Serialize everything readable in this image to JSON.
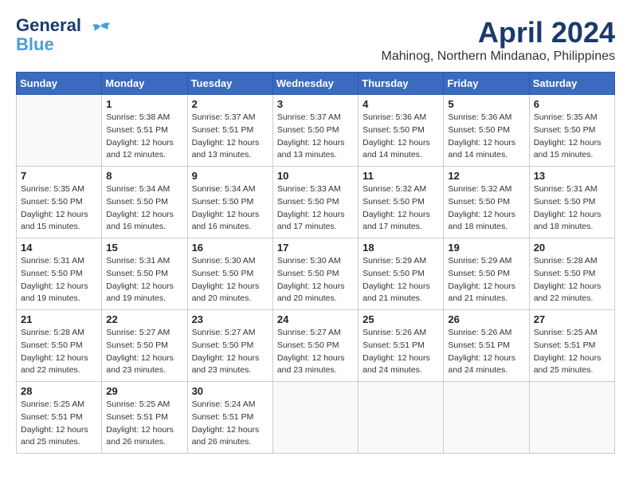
{
  "header": {
    "logo_line1": "General",
    "logo_line2": "Blue",
    "month_year": "April 2024",
    "location": "Mahinog, Northern Mindanao, Philippines"
  },
  "days_of_week": [
    "Sunday",
    "Monday",
    "Tuesday",
    "Wednesday",
    "Thursday",
    "Friday",
    "Saturday"
  ],
  "weeks": [
    [
      {
        "day": "",
        "info": ""
      },
      {
        "day": "1",
        "info": "Sunrise: 5:38 AM\nSunset: 5:51 PM\nDaylight: 12 hours\nand 12 minutes."
      },
      {
        "day": "2",
        "info": "Sunrise: 5:37 AM\nSunset: 5:51 PM\nDaylight: 12 hours\nand 13 minutes."
      },
      {
        "day": "3",
        "info": "Sunrise: 5:37 AM\nSunset: 5:50 PM\nDaylight: 12 hours\nand 13 minutes."
      },
      {
        "day": "4",
        "info": "Sunrise: 5:36 AM\nSunset: 5:50 PM\nDaylight: 12 hours\nand 14 minutes."
      },
      {
        "day": "5",
        "info": "Sunrise: 5:36 AM\nSunset: 5:50 PM\nDaylight: 12 hours\nand 14 minutes."
      },
      {
        "day": "6",
        "info": "Sunrise: 5:35 AM\nSunset: 5:50 PM\nDaylight: 12 hours\nand 15 minutes."
      }
    ],
    [
      {
        "day": "7",
        "info": "Sunrise: 5:35 AM\nSunset: 5:50 PM\nDaylight: 12 hours\nand 15 minutes."
      },
      {
        "day": "8",
        "info": "Sunrise: 5:34 AM\nSunset: 5:50 PM\nDaylight: 12 hours\nand 16 minutes."
      },
      {
        "day": "9",
        "info": "Sunrise: 5:34 AM\nSunset: 5:50 PM\nDaylight: 12 hours\nand 16 minutes."
      },
      {
        "day": "10",
        "info": "Sunrise: 5:33 AM\nSunset: 5:50 PM\nDaylight: 12 hours\nand 17 minutes."
      },
      {
        "day": "11",
        "info": "Sunrise: 5:32 AM\nSunset: 5:50 PM\nDaylight: 12 hours\nand 17 minutes."
      },
      {
        "day": "12",
        "info": "Sunrise: 5:32 AM\nSunset: 5:50 PM\nDaylight: 12 hours\nand 18 minutes."
      },
      {
        "day": "13",
        "info": "Sunrise: 5:31 AM\nSunset: 5:50 PM\nDaylight: 12 hours\nand 18 minutes."
      }
    ],
    [
      {
        "day": "14",
        "info": "Sunrise: 5:31 AM\nSunset: 5:50 PM\nDaylight: 12 hours\nand 19 minutes."
      },
      {
        "day": "15",
        "info": "Sunrise: 5:31 AM\nSunset: 5:50 PM\nDaylight: 12 hours\nand 19 minutes."
      },
      {
        "day": "16",
        "info": "Sunrise: 5:30 AM\nSunset: 5:50 PM\nDaylight: 12 hours\nand 20 minutes."
      },
      {
        "day": "17",
        "info": "Sunrise: 5:30 AM\nSunset: 5:50 PM\nDaylight: 12 hours\nand 20 minutes."
      },
      {
        "day": "18",
        "info": "Sunrise: 5:29 AM\nSunset: 5:50 PM\nDaylight: 12 hours\nand 21 minutes."
      },
      {
        "day": "19",
        "info": "Sunrise: 5:29 AM\nSunset: 5:50 PM\nDaylight: 12 hours\nand 21 minutes."
      },
      {
        "day": "20",
        "info": "Sunrise: 5:28 AM\nSunset: 5:50 PM\nDaylight: 12 hours\nand 22 minutes."
      }
    ],
    [
      {
        "day": "21",
        "info": "Sunrise: 5:28 AM\nSunset: 5:50 PM\nDaylight: 12 hours\nand 22 minutes."
      },
      {
        "day": "22",
        "info": "Sunrise: 5:27 AM\nSunset: 5:50 PM\nDaylight: 12 hours\nand 23 minutes."
      },
      {
        "day": "23",
        "info": "Sunrise: 5:27 AM\nSunset: 5:50 PM\nDaylight: 12 hours\nand 23 minutes."
      },
      {
        "day": "24",
        "info": "Sunrise: 5:27 AM\nSunset: 5:50 PM\nDaylight: 12 hours\nand 23 minutes."
      },
      {
        "day": "25",
        "info": "Sunrise: 5:26 AM\nSunset: 5:51 PM\nDaylight: 12 hours\nand 24 minutes."
      },
      {
        "day": "26",
        "info": "Sunrise: 5:26 AM\nSunset: 5:51 PM\nDaylight: 12 hours\nand 24 minutes."
      },
      {
        "day": "27",
        "info": "Sunrise: 5:25 AM\nSunset: 5:51 PM\nDaylight: 12 hours\nand 25 minutes."
      }
    ],
    [
      {
        "day": "28",
        "info": "Sunrise: 5:25 AM\nSunset: 5:51 PM\nDaylight: 12 hours\nand 25 minutes."
      },
      {
        "day": "29",
        "info": "Sunrise: 5:25 AM\nSunset: 5:51 PM\nDaylight: 12 hours\nand 26 minutes."
      },
      {
        "day": "30",
        "info": "Sunrise: 5:24 AM\nSunset: 5:51 PM\nDaylight: 12 hours\nand 26 minutes."
      },
      {
        "day": "",
        "info": ""
      },
      {
        "day": "",
        "info": ""
      },
      {
        "day": "",
        "info": ""
      },
      {
        "day": "",
        "info": ""
      }
    ]
  ]
}
